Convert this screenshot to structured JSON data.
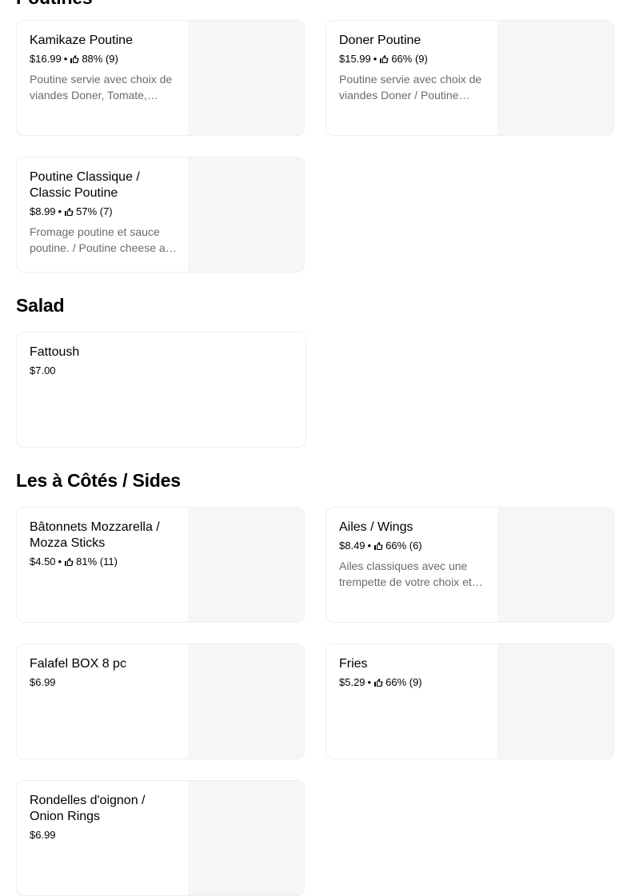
{
  "sections": {
    "poutines": {
      "title": "Poutines"
    },
    "salad": {
      "title": "Salad"
    },
    "sides": {
      "title": "Les à Côtés / Sides"
    }
  },
  "items": {
    "kamikaze": {
      "name": "Kamikaze Poutine",
      "price": "$16.99",
      "rating": "88% (9)",
      "description": "Poutine servie avec choix de viandes Doner, Tomate, oignons, sauce piquante"
    },
    "doner": {
      "name": "Doner Poutine",
      "price": "$15.99",
      "rating": "66% (9)",
      "description": "Poutine servie avec choix de viandes Doner / Poutine served with choice of Doner meat"
    },
    "classic": {
      "name": "Poutine Classique / Classic Poutine",
      "price": "$8.99",
      "rating": "57% (7)",
      "description": "Fromage poutine et sauce poutine. / Poutine cheese and poutine sauce."
    },
    "fattoush": {
      "name": "Fattoush",
      "price": "$7.00"
    },
    "mozza": {
      "name": "Bâtonnets Mozzarella / Mozza Sticks",
      "price": "$4.50",
      "rating": "81% (11)"
    },
    "wings": {
      "name": "Ailes / Wings",
      "price": "$8.49",
      "rating": "66% (6)",
      "description": "Ailes classiques avec une trempette de votre choix et sauce"
    },
    "falafel": {
      "name": "Falafel BOX 8 pc",
      "price": "$6.99"
    },
    "fries": {
      "name": "Fries",
      "price": "$5.29",
      "rating": "66% (9)"
    },
    "onion": {
      "name": "Rondelles d'oignon / Onion Rings",
      "price": "$6.99"
    }
  },
  "separator": "•",
  "icons": {
    "rating": "thumbs-up-icon"
  },
  "colors": {
    "description": "#6b6b6b",
    "border": "#eeeeee",
    "thumb": "#f6f6f6"
  }
}
